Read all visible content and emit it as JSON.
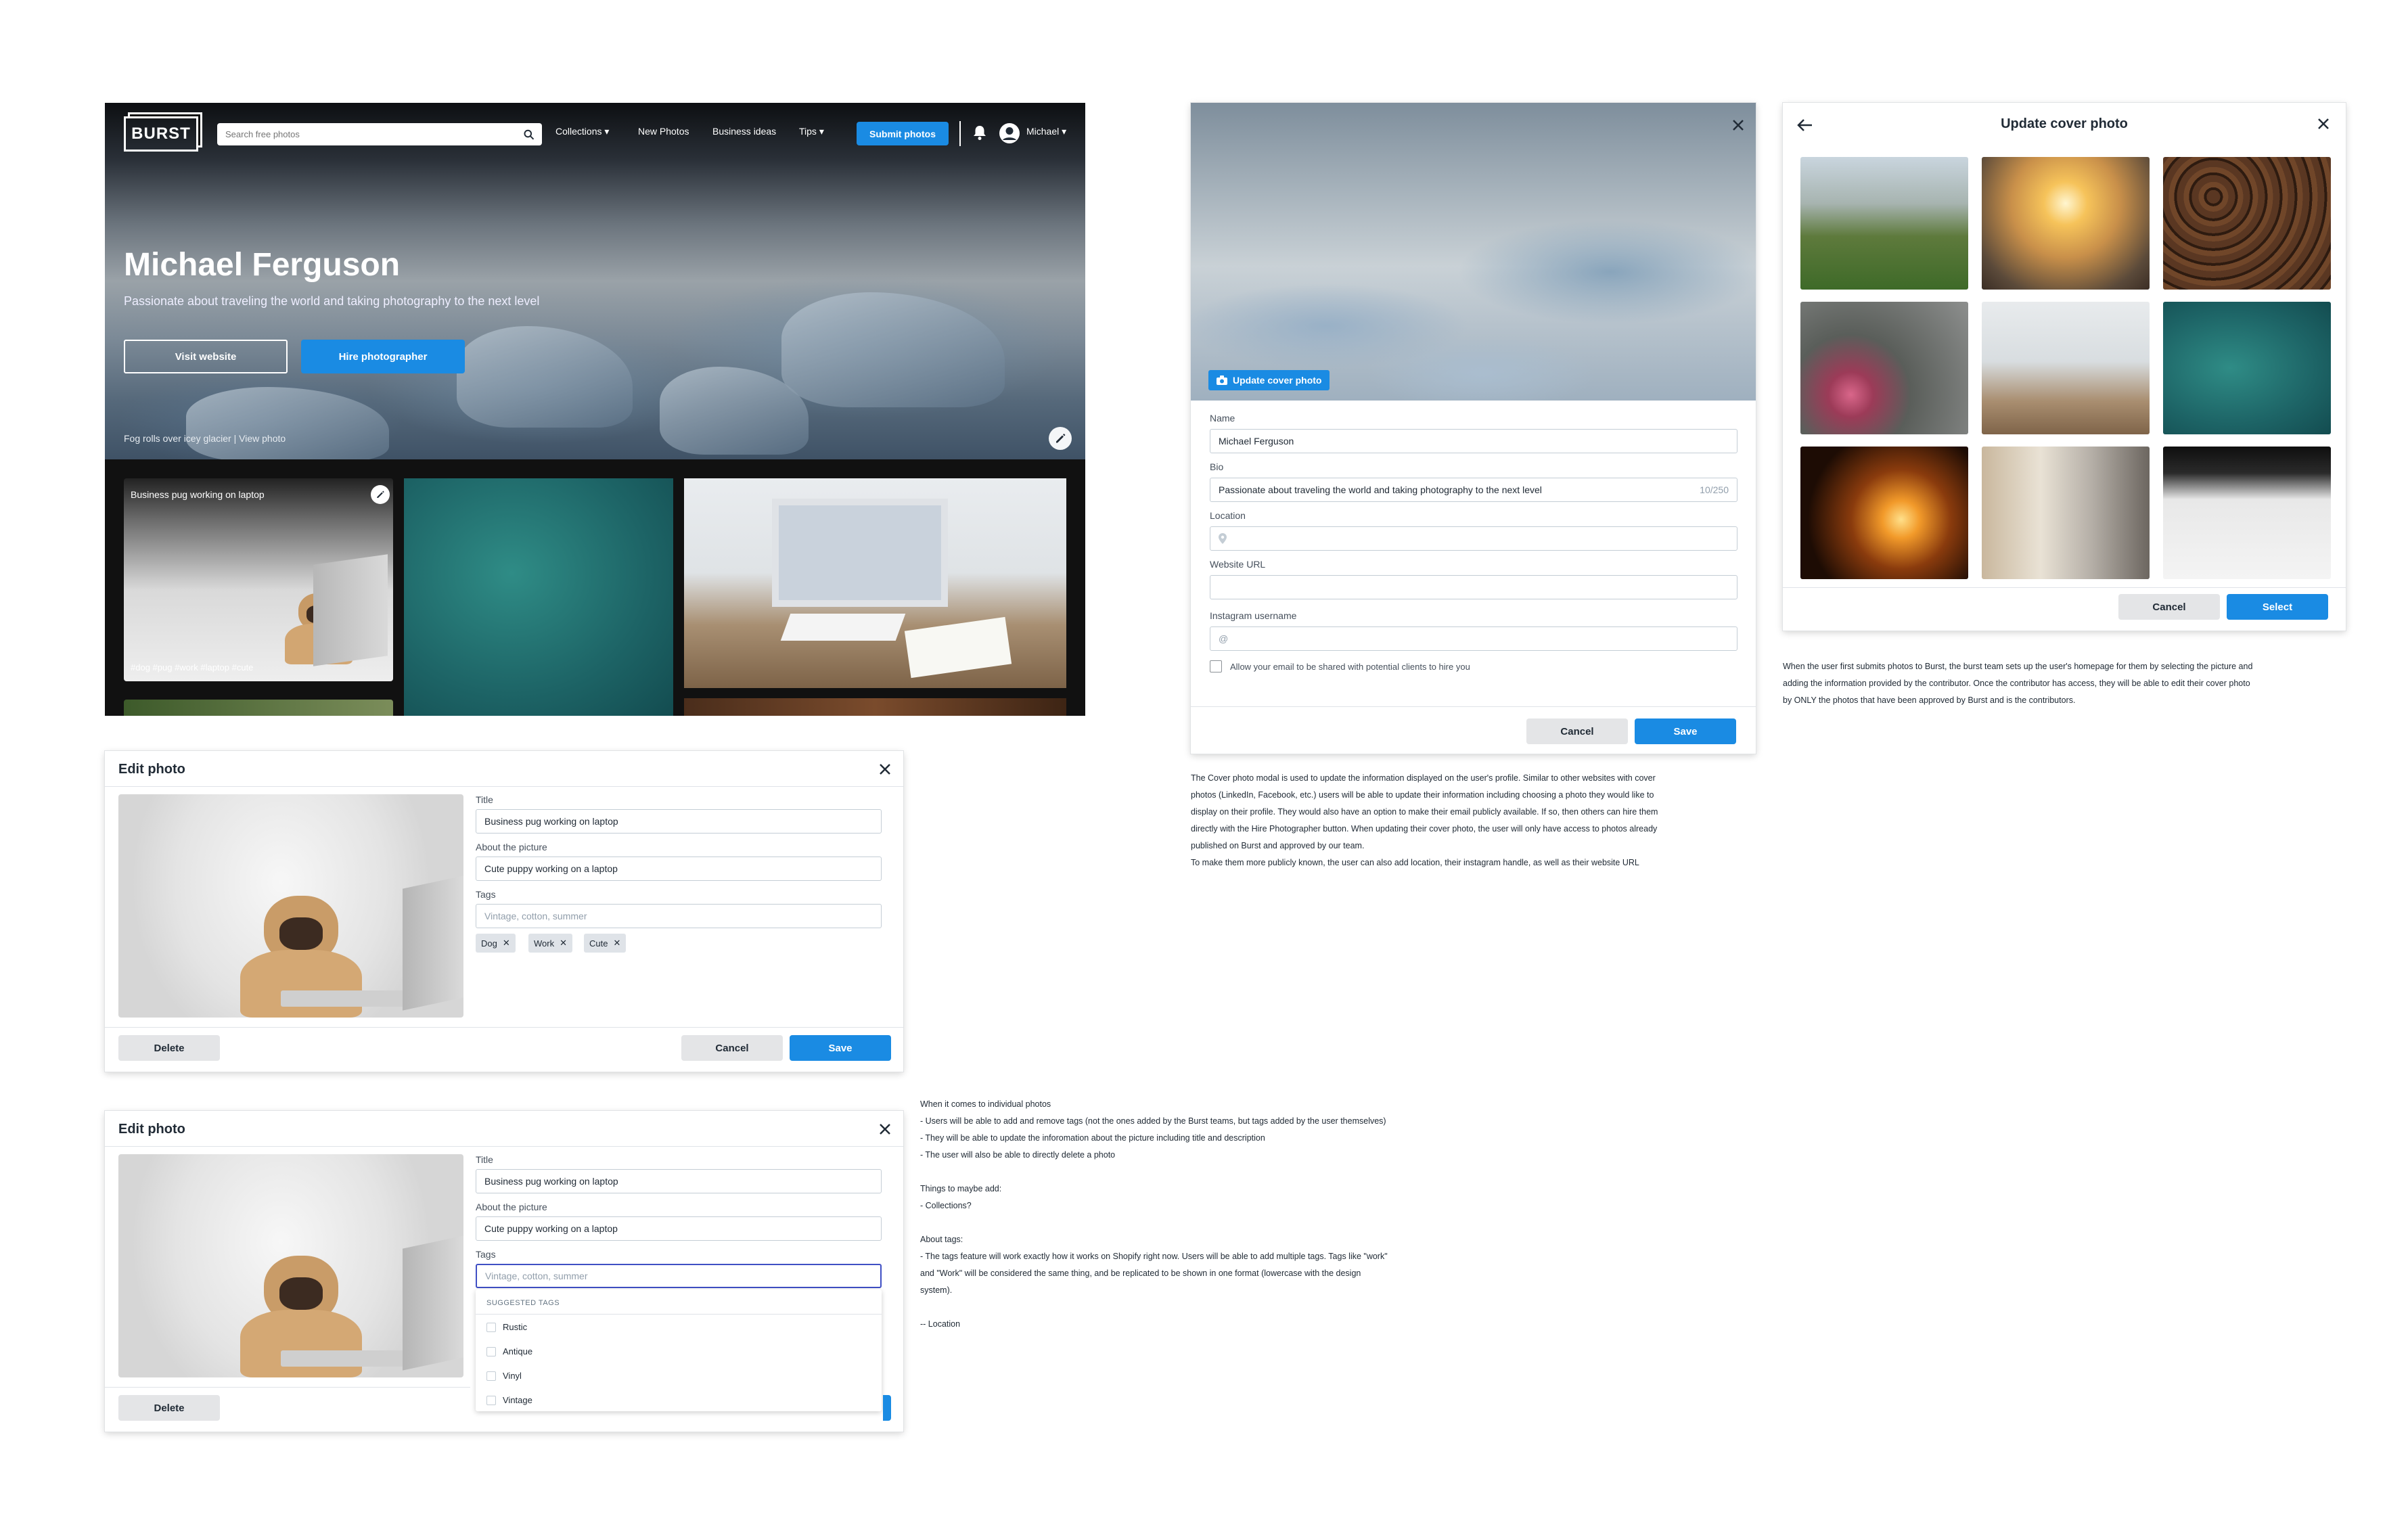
{
  "colors": {
    "accent": "#1a8be3",
    "button_gray": "#e4e5e7",
    "text": "#212b36"
  },
  "profile": {
    "logo": "BURST",
    "search_placeholder": "Search free photos",
    "nav": {
      "collections": "Collections",
      "new_photos": "New Photos",
      "business_ideas": "Business ideas",
      "tips": "Tips",
      "submit": "Submit photos",
      "user": "Michael"
    },
    "name": "Michael Ferguson",
    "tagline": "Passionate about traveling the world and taking photography to the next level",
    "visit_website": "Visit website",
    "hire": "Hire photographer",
    "caption": "Fog rolls over icey glacier | View photo",
    "tile1": {
      "title": "Business pug working on laptop",
      "tags": "#dog #pug #work #laptop #cute"
    }
  },
  "edit_photo_1": {
    "title": "Edit photo",
    "title_label": "Title",
    "title_value": "Business pug working on laptop",
    "about_label": "About the picture",
    "about_value": "Cute puppy working on a laptop",
    "tags_label": "Tags",
    "tags_placeholder": "Vintage, cotton, summer",
    "chips": [
      "Dog",
      "Work",
      "Cute"
    ],
    "delete": "Delete",
    "cancel": "Cancel",
    "save": "Save"
  },
  "edit_photo_2": {
    "title": "Edit photo",
    "title_label": "Title",
    "title_value": "Business pug working on laptop",
    "about_label": "About the picture",
    "about_value": "Cute puppy working on a laptop",
    "tags_label": "Tags",
    "tags_placeholder": "Vintage, cotton, summer",
    "suggested_header": "SUGGESTED TAGS",
    "suggested": [
      "Rustic",
      "Antique",
      "Vinyl",
      "Vintage"
    ],
    "delete": "Delete"
  },
  "cover_modal": {
    "update_cover": "Update cover photo",
    "name_label": "Name",
    "name_value": "Michael Ferguson",
    "bio_label": "Bio",
    "bio_value": "Passionate about traveling the world and taking photography to the next level",
    "bio_count": "10/250",
    "location_label": "Location",
    "website_label": "Website URL",
    "instagram_label": "Instagram username",
    "instagram_prefix": "@",
    "checkbox_label": "Allow your email to be shared with potential clients to hire you",
    "cancel": "Cancel",
    "save": "Save"
  },
  "update_cover": {
    "title": "Update cover photo",
    "cancel": "Cancel",
    "select": "Select"
  },
  "notes": {
    "cover": "The Cover photo modal is used to update the information displayed on the user's profile. Similar to other websites with cover\nphotos (LinkedIn, Facebook, etc.) users will be able to update their information including choosing a photo they would like to\ndisplay on their profile. They would also have an option to make their email publicly available. If so, then others can hire them\ndirectly with the Hire Photographer button. When updating their cover photo, the user will only have access to photos already\npublished on Burst and approved by our team.\nTo make them more publicly known, the user can also add location, their instagram handle, as well as their website URL",
    "select": "When the user first submits photos to Burst, the burst team sets up the user's homepage for them by selecting the picture and\nadding the information provided by the contributor. Once the contributor has access, they will be able to edit their cover photo\nby ONLY the photos that have been approved by Burst and is the contributors.",
    "photos": "When it comes to individual photos\n- Users will be able to add and remove tags (not the ones added by the Burst teams, but tags added by the user themselves)\n- They will be able to update the inforomation about the picture including title and description\n- The user will also be able to directly delete a photo\n\nThings to maybe add:\n- Collections?\n\nAbout tags:\n- The tags feature will work exactly how it works on Shopify right now. Users will be able to add multiple tags. Tags like \"work\"\nand \"Work\" will be considered the same thing, and be replicated to be shown in one format (lowercase with the design\nsystem).\n\n-- Location"
  }
}
